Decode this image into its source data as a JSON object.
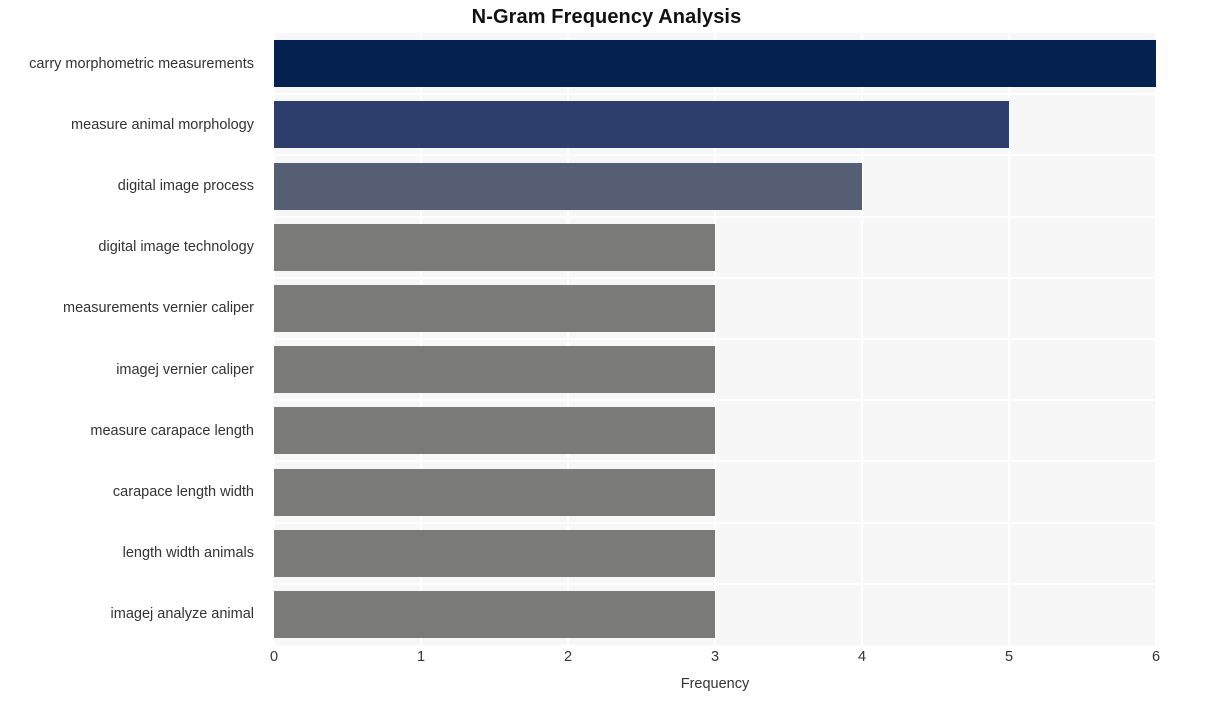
{
  "chart_data": {
    "type": "bar",
    "orientation": "horizontal",
    "title": "N-Gram Frequency Analysis",
    "xlabel": "Frequency",
    "ylabel": "",
    "xlim": [
      0,
      6
    ],
    "xticks": [
      "0",
      "1",
      "2",
      "3",
      "4",
      "5",
      "6"
    ],
    "grid": true,
    "legend": null,
    "categories": [
      "carry morphometric measurements",
      "measure animal morphology",
      "digital image process",
      "digital image technology",
      "measurements vernier caliper",
      "imagej vernier caliper",
      "measure carapace length",
      "carapace length width",
      "length width animals",
      "imagej analyze animal"
    ],
    "values": [
      6,
      5,
      4,
      3,
      3,
      3,
      3,
      3,
      3,
      3
    ],
    "bar_colors": [
      "#042150",
      "#2d3e6c",
      "#565e74",
      "#7a7a78",
      "#7a7a78",
      "#7a7a78",
      "#7a7a78",
      "#7a7a78",
      "#7a7a78",
      "#7a7a78"
    ]
  },
  "style": {
    "figure_background": "#ffffff",
    "plot_background": "#f7f7f7",
    "gridline_color": "#ffffff",
    "text_color": "#333333",
    "title_color": "#111111"
  }
}
